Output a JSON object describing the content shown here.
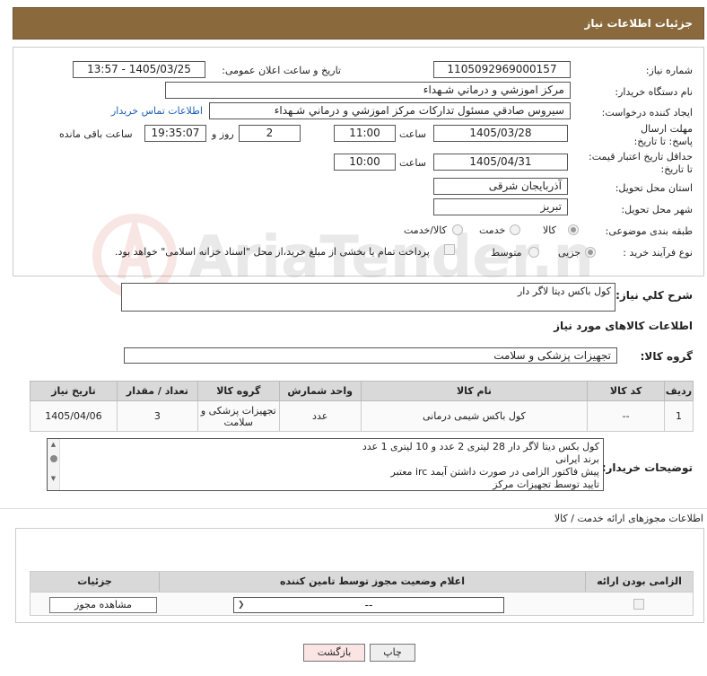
{
  "header": {
    "title": "جزئیات اطلاعات نیاز"
  },
  "form": {
    "need_number_label": "شماره نیاز:",
    "need_number": "1105092969000157",
    "announce_label": "تاریخ و ساعت اعلان عمومی:",
    "announce_value": "1405/03/25 - 13:57",
    "buyer_org_label": "نام دستگاه خریدار:",
    "buyer_org": "مرکز اموزشي و درماني شـهداء",
    "creator_label": "ایجاد کننده درخواست:",
    "creator": "سیروس  صادقي مسئول تدارکات مرکز اموزشي و درماني شـهداء",
    "contact_link": "اطلاعات تماس خریدار",
    "deadline_label": "مهلت ارسال پاسخ: تا تاریخ:",
    "deadline_date": "1405/03/28",
    "time_label": "ساعت",
    "deadline_time": "11:00",
    "days_value": "2",
    "days_label": "روز و",
    "remaining_time": "19:35:07",
    "remaining_label": "ساعت باقی مانده",
    "validity_label": "حداقل تاریخ اعتبار قیمت: تا تاریخ:",
    "validity_date": "1405/04/31",
    "validity_time": "10:00",
    "province_label": "استان محل تحویل:",
    "province": "آذربایجان شرقی",
    "city_label": "شهر محل تحویل:",
    "city": "تبریز",
    "category_label": "طبقه بندی موضوعی:",
    "category_options": [
      "کالا",
      "خدمت",
      "کالا/خدمت"
    ],
    "process_label": "نوع فرآیند خرید :",
    "process_options": [
      "جزیی",
      "متوسط"
    ],
    "payment_note": "پرداخت تمام یا بخشی از مبلغ خرید،از محل \"اسناد خزانه اسلامی\" خواهد بود."
  },
  "description": {
    "label": "شرح کلي نیاز:",
    "value": "کول باکس دیتا لاگر دار"
  },
  "goods": {
    "section_title": "اطلاعات کالاهای مورد نیاز",
    "group_label": "گروه کالا:",
    "group_value": "تجهیزات پزشکی و سلامت",
    "columns": [
      "ردیف",
      "کد کالا",
      "نام کالا",
      "واحد شمارش",
      "گروه کالا",
      "تعداد / مقدار",
      "تاریخ نیاز"
    ],
    "rows": [
      {
        "row": "1",
        "code": "--",
        "name": "کول باکس شیمی درمانی",
        "unit": "عدد",
        "group": "تجهیزات پزشکی و سلامت",
        "qty": "3",
        "date": "1405/04/06"
      }
    ]
  },
  "buyer_notes": {
    "label": "توضیحات خریدار:",
    "lines": [
      "کول بکس دیتا لاگر دار 28 لیتری 2 عدد و 10 لیتری 1 عدد",
      "برند ایرانی",
      "پیش فاکتور الزامی در صورت داشتن آیمد irc  معتبر",
      "تایید  توسط تجهیزات مرکز"
    ]
  },
  "permits": {
    "section_title": "اطلاعات مجوزهای ارائه خدمت / کالا",
    "columns": [
      "الزامی بودن ارائه مجوز",
      "اعلام وضعیت مجوز توسط تامین کننده",
      "جزئیات"
    ],
    "select_value": "--",
    "view_button": "مشاهده مجوز"
  },
  "footer": {
    "print_button": "چاپ",
    "back_button": "بازگشت"
  },
  "watermark": {
    "text": "AriaTender.neT"
  }
}
